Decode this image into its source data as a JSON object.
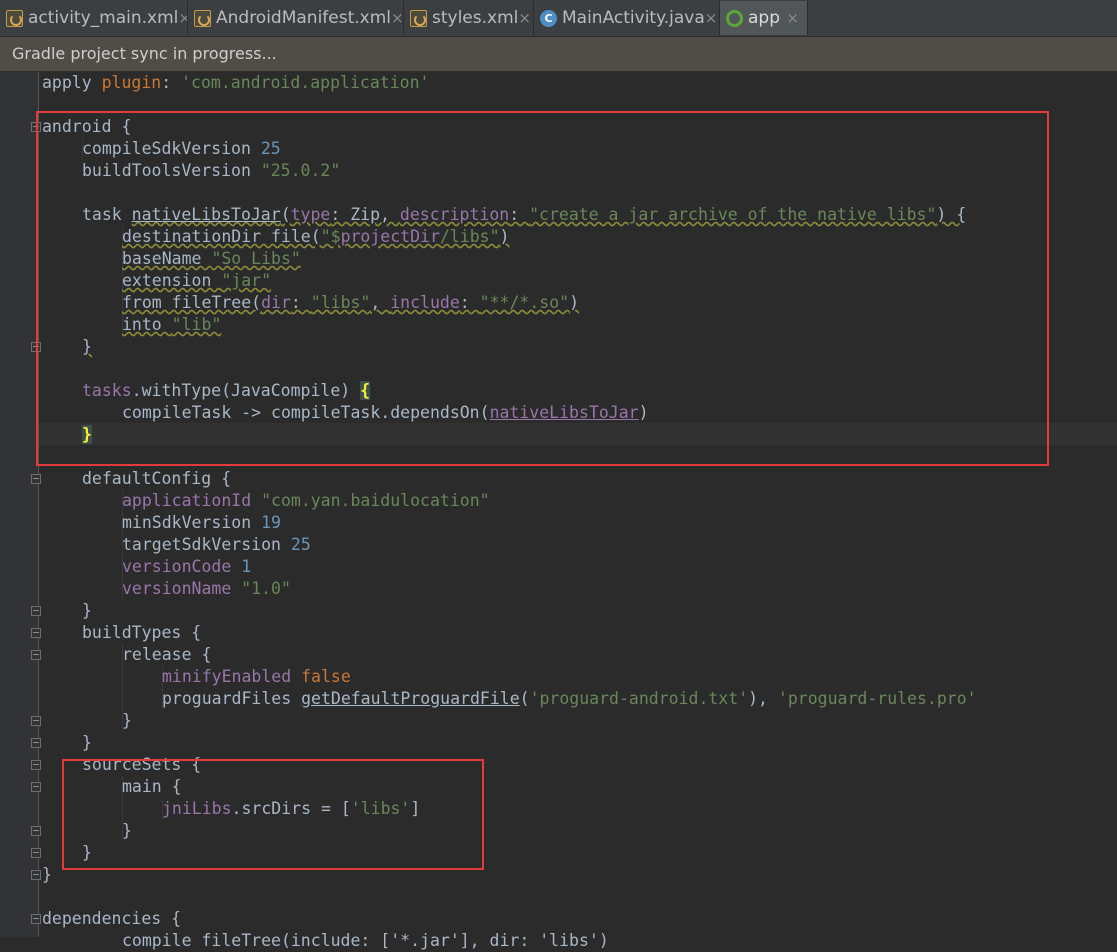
{
  "tabs": [
    {
      "label": "activity_main.xml",
      "icon": "xml-file-icon",
      "active": false
    },
    {
      "label": "AndroidManifest.xml",
      "icon": "xml-file-icon",
      "active": false
    },
    {
      "label": "styles.xml",
      "icon": "xml-file-icon",
      "active": false
    },
    {
      "label": "MainActivity.java",
      "icon": "java-class-icon",
      "active": false
    },
    {
      "label": "app",
      "icon": "gradle-module-icon",
      "active": true
    }
  ],
  "tab_close_glyph": "×",
  "java_icon_letter": "C",
  "banner": {
    "text": "Gradle project sync in progress..."
  },
  "code": {
    "l01_a": "apply ",
    "l01_b": "plugin",
    "l01_c": ": ",
    "l01_d": "'com.android.application'",
    "l03": "android {",
    "l04_a": "compileSdkVersion ",
    "l04_b": "25",
    "l05_a": "buildToolsVersion ",
    "l05_b": "\"25.0.2\"",
    "l07_a": "task ",
    "l07_b": "nativeLibsToJar",
    "l07_c": "(",
    "l07_d": "type",
    "l07_e": ": Zip, ",
    "l07_f": "description",
    "l07_g": ": ",
    "l07_h": "\"create a jar archive of the native libs\"",
    "l07_i": ") {",
    "l08_a": "destinationDir file(",
    "l08_b": "\"$",
    "l08_c": "projectDir",
    "l08_d": "/libs\"",
    "l08_e": ")",
    "l09_a": "baseName ",
    "l09_b": "\"So Libs\"",
    "l10_a": "extension ",
    "l10_b": "\"jar\"",
    "l11_a": "from fileTree(",
    "l11_b": "dir",
    "l11_c": ": ",
    "l11_d": "\"libs\"",
    "l11_e": ", ",
    "l11_f": "include",
    "l11_g": ": ",
    "l11_h": "\"**/*.so\"",
    "l11_i": ")",
    "l12_a": "into ",
    "l12_b": "\"lib\"",
    "l13": "}",
    "l15_a": "tasks",
    "l15_b": ".withType(JavaCompile) ",
    "l15_c": "{",
    "l16_a": "compileTask -> compileTask.dependsOn(",
    "l16_b": "nativeLibsToJar",
    "l16_c": ")",
    "l17": "}",
    "l19": "defaultConfig {",
    "l20_a": "applicationId ",
    "l20_b": "\"com.yan.baidulocation\"",
    "l21_a": "minSdkVersion ",
    "l21_b": "19",
    "l22_a": "targetSdkVersion ",
    "l22_b": "25",
    "l23_a": "versionCode ",
    "l23_b": "1",
    "l24_a": "versionName ",
    "l24_b": "\"1.0\"",
    "l25": "}",
    "l26": "buildTypes {",
    "l27": "release {",
    "l28_a": "minifyEnabled ",
    "l28_b": "false",
    "l29_a": "proguardFiles ",
    "l29_b": "getDefaultProguardFile",
    "l29_c": "(",
    "l29_d": "'proguard-android.txt'",
    "l29_e": "), ",
    "l29_f": "'proguard-rules.pro'",
    "l30": "}",
    "l31": "}",
    "l32": "sourceSets {",
    "l33": "main {",
    "l34_a": "jniLibs",
    "l34_b": ".srcDirs = [",
    "l34_c": "'libs'",
    "l34_d": "]",
    "l35": "}",
    "l36": "}",
    "l37": "}",
    "l39": "dependencies {",
    "l40": "compile fileTree(include: ['*.jar'], dir: 'libs')"
  }
}
